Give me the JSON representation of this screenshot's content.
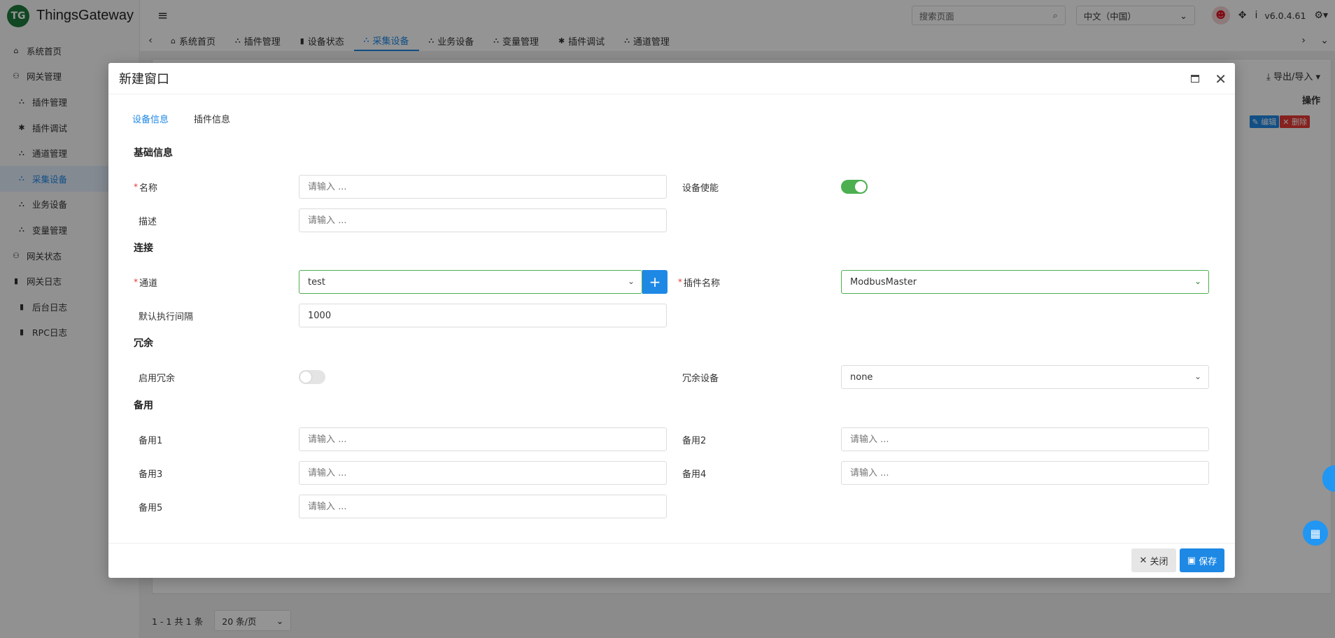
{
  "app": {
    "logo_text": "TG",
    "name": "ThingsGateway",
    "version": "v6.0.4.61"
  },
  "sidebar": {
    "items": [
      {
        "label": "系统首页"
      },
      {
        "label": "网关管理"
      },
      {
        "label": "插件管理"
      },
      {
        "label": "插件调试"
      },
      {
        "label": "通道管理"
      },
      {
        "label": "采集设备"
      },
      {
        "label": "业务设备"
      },
      {
        "label": "变量管理"
      },
      {
        "label": "网关状态"
      },
      {
        "label": "网关日志"
      },
      {
        "label": "后台日志"
      },
      {
        "label": "RPC日志"
      }
    ]
  },
  "header": {
    "search_placeholder": "搜索页面",
    "language": "中文（中国）"
  },
  "tabs": [
    {
      "label": "系统首页"
    },
    {
      "label": "插件管理"
    },
    {
      "label": "设备状态"
    },
    {
      "label": "采集设备"
    },
    {
      "label": "业务设备"
    },
    {
      "label": "变量管理"
    },
    {
      "label": "插件调试"
    },
    {
      "label": "通道管理"
    }
  ],
  "background": {
    "export_label": "导出/导入",
    "op_header": "操作",
    "edit_label": "编辑",
    "delete_label": "删除",
    "pager_text": "1 - 1 共 1 条",
    "page_size": "20 条/页"
  },
  "modal": {
    "title": "新建窗口",
    "tabs": [
      {
        "label": "设备信息"
      },
      {
        "label": "插件信息"
      }
    ],
    "sections": {
      "basic": "基础信息",
      "connection": "连接",
      "redundancy": "冗余",
      "backup": "备用"
    },
    "fields": {
      "name": {
        "label": "名称",
        "placeholder": "请输入 ..."
      },
      "enable": {
        "label": "设备使能"
      },
      "description": {
        "label": "描述",
        "placeholder": "请输入 ..."
      },
      "channel": {
        "label": "通道",
        "value": "test"
      },
      "plugin_name": {
        "label": "插件名称",
        "value": "ModbusMaster"
      },
      "interval": {
        "label": "默认执行间隔",
        "value": "1000"
      },
      "redundancy_enable": {
        "label": "启用冗余"
      },
      "redundancy_device": {
        "label": "冗余设备",
        "value": "none"
      },
      "backup1": {
        "label": "备用1",
        "placeholder": "请输入 ..."
      },
      "backup2": {
        "label": "备用2",
        "placeholder": "请输入 ..."
      },
      "backup3": {
        "label": "备用3",
        "placeholder": "请输入 ..."
      },
      "backup4": {
        "label": "备用4",
        "placeholder": "请输入 ..."
      },
      "backup5": {
        "label": "备用5",
        "placeholder": "请输入 ..."
      }
    },
    "footer": {
      "close_label": "关闭",
      "save_label": "保存"
    }
  },
  "colors": {
    "accent": "#1e88e5",
    "switch_on": "#4caf50",
    "danger": "#e53935"
  }
}
